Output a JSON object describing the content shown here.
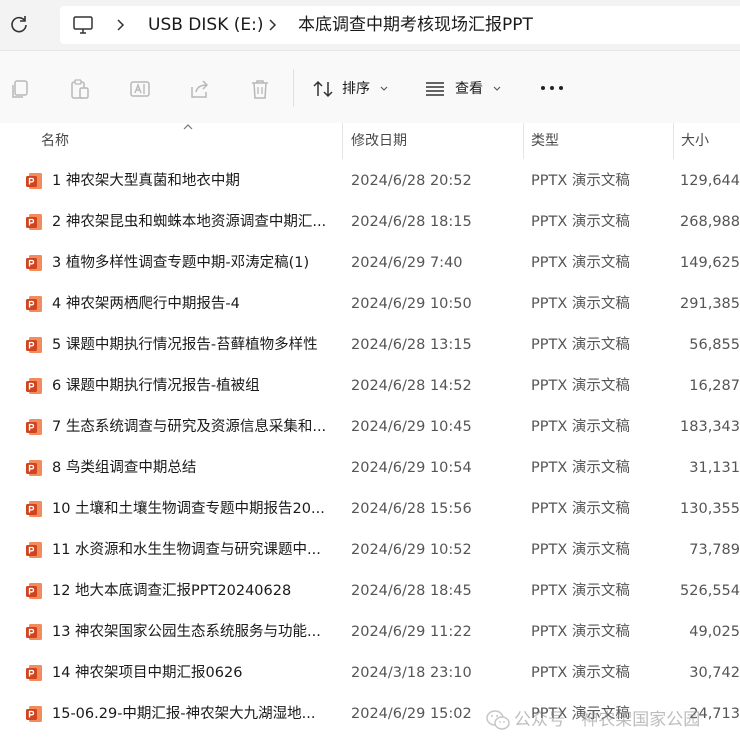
{
  "address_bar": {
    "refresh_icon": "refresh-icon",
    "root_icon": "this-pc-icon",
    "crumbs": [
      "USB DISK (E:)",
      "本底调查中期考核现场汇报PPT"
    ]
  },
  "toolbar": {
    "icons": [
      "copy-icon",
      "paste-icon",
      "rename-icon",
      "share-icon",
      "delete-icon"
    ],
    "sort_label": "排序",
    "view_label": "查看",
    "more_label": "···"
  },
  "columns": {
    "name": "名称",
    "modified": "修改日期",
    "type": "类型",
    "size": "大小"
  },
  "files": [
    {
      "name": "1 神农架大型真菌和地衣中期",
      "modified": "2024/6/28 20:52",
      "type": "PPTX 演示文稿",
      "size": "129,644"
    },
    {
      "name": "2 神农架昆虫和蜘蛛本地资源调查中期汇...",
      "modified": "2024/6/28 18:15",
      "type": "PPTX 演示文稿",
      "size": "268,988"
    },
    {
      "name": "3 植物多样性调查专题中期-邓涛定稿(1)",
      "modified": "2024/6/29 7:40",
      "type": "PPTX 演示文稿",
      "size": "149,625"
    },
    {
      "name": "4 神农架两栖爬行中期报告-4",
      "modified": "2024/6/29 10:50",
      "type": "PPTX 演示文稿",
      "size": "291,385"
    },
    {
      "name": "5 课题中期执行情况报告-苔藓植物多样性",
      "modified": "2024/6/28 13:15",
      "type": "PPTX 演示文稿",
      "size": "56,855"
    },
    {
      "name": "6 课题中期执行情况报告-植被组",
      "modified": "2024/6/28 14:52",
      "type": "PPTX 演示文稿",
      "size": "16,287"
    },
    {
      "name": "7 生态系统调查与研究及资源信息采集和...",
      "modified": "2024/6/29 10:45",
      "type": "PPTX 演示文稿",
      "size": "183,343"
    },
    {
      "name": "8 鸟类组调查中期总结",
      "modified": "2024/6/29 10:54",
      "type": "PPTX 演示文稿",
      "size": "31,131"
    },
    {
      "name": "10 土壤和土壤生物调查专题中期报告20...",
      "modified": "2024/6/28 15:56",
      "type": "PPTX 演示文稿",
      "size": "130,355"
    },
    {
      "name": "11 水资源和水生生物调查与研究课题中...",
      "modified": "2024/6/29 10:52",
      "type": "PPTX 演示文稿",
      "size": "73,789"
    },
    {
      "name": "12 地大本底调查汇报PPT20240628",
      "modified": "2024/6/28 18:45",
      "type": "PPTX 演示文稿",
      "size": "526,554"
    },
    {
      "name": "13 神农架国家公园生态系统服务与功能...",
      "modified": "2024/6/29 11:22",
      "type": "PPTX 演示文稿",
      "size": "49,025"
    },
    {
      "name": "14 神农架项目中期汇报0626",
      "modified": "2024/3/18 23:10",
      "type": "PPTX 演示文稿",
      "size": "30,742"
    },
    {
      "name": "15-06.29-中期汇报-神农架大九湖湿地...",
      "modified": "2024/6/29 15:02",
      "type": "PPTX 演示文稿",
      "size": "24,713"
    }
  ],
  "watermark": {
    "logo": "wechat-logo",
    "text": "公众号 · 神农架国家公园"
  },
  "colors": {
    "pptx_icon": "#d0441f",
    "pptx_icon_light": "#f28c5c"
  }
}
